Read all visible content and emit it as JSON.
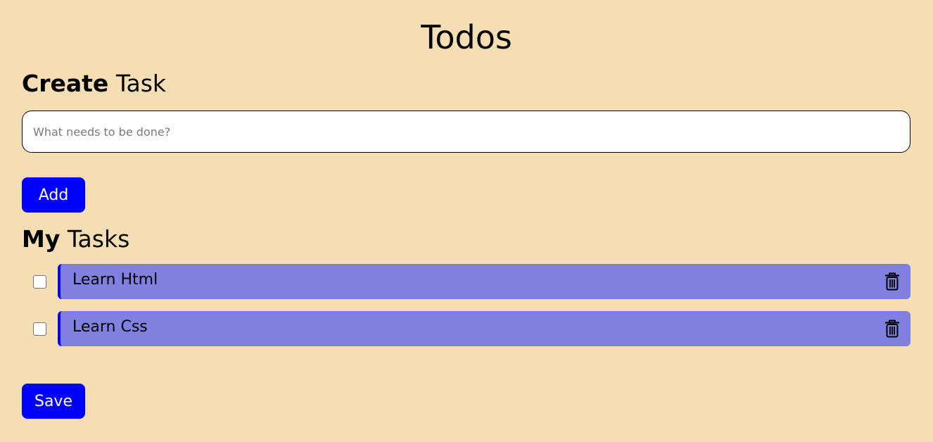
{
  "header": {
    "title": "Todos"
  },
  "create": {
    "heading_bold": "Create",
    "heading_rest": "Task",
    "placeholder": "What needs to be done?",
    "value": "",
    "add_label": "Add"
  },
  "tasks": {
    "heading_bold": "My",
    "heading_rest": "Tasks",
    "items": [
      {
        "label": "Learn Html",
        "done": false,
        "delete_icon": "trash-icon"
      },
      {
        "label": "Learn Css",
        "done": false,
        "delete_icon": "trash-icon"
      }
    ]
  },
  "footer": {
    "save_label": "Save"
  },
  "colors": {
    "background": "#f5deb3",
    "accent": "#0000ff",
    "task_card": "#8080df"
  }
}
